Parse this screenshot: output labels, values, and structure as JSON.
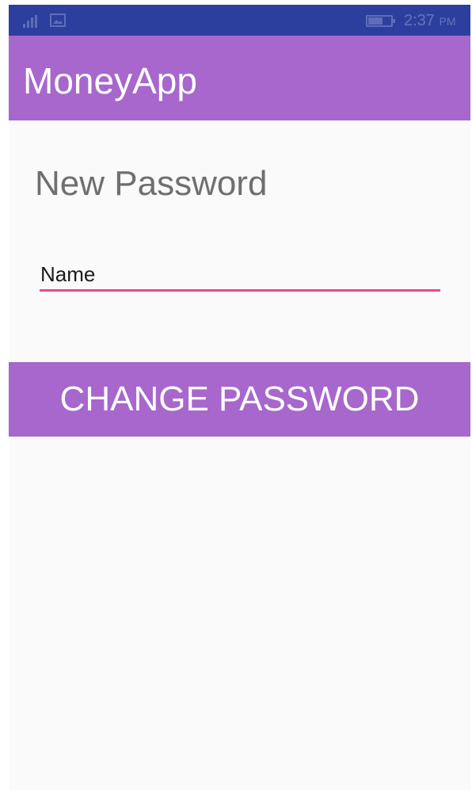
{
  "status_bar": {
    "time": "2:37",
    "ampm": "PM",
    "icons": [
      "signal-icon",
      "gallery-icon",
      "battery-icon"
    ],
    "color": "#2d3f9e"
  },
  "app_bar": {
    "title": "MoneyApp",
    "color": "#a767cc"
  },
  "form": {
    "title": "New Password",
    "name_field": {
      "value": "Name",
      "underline_color": "#e84a8c"
    },
    "submit_label": "CHANGE PASSWORD"
  },
  "colors": {
    "background": "#fafafa",
    "accent": "#a767cc",
    "status_bar": "#2d3f9e",
    "field_underline": "#e84a8c"
  }
}
